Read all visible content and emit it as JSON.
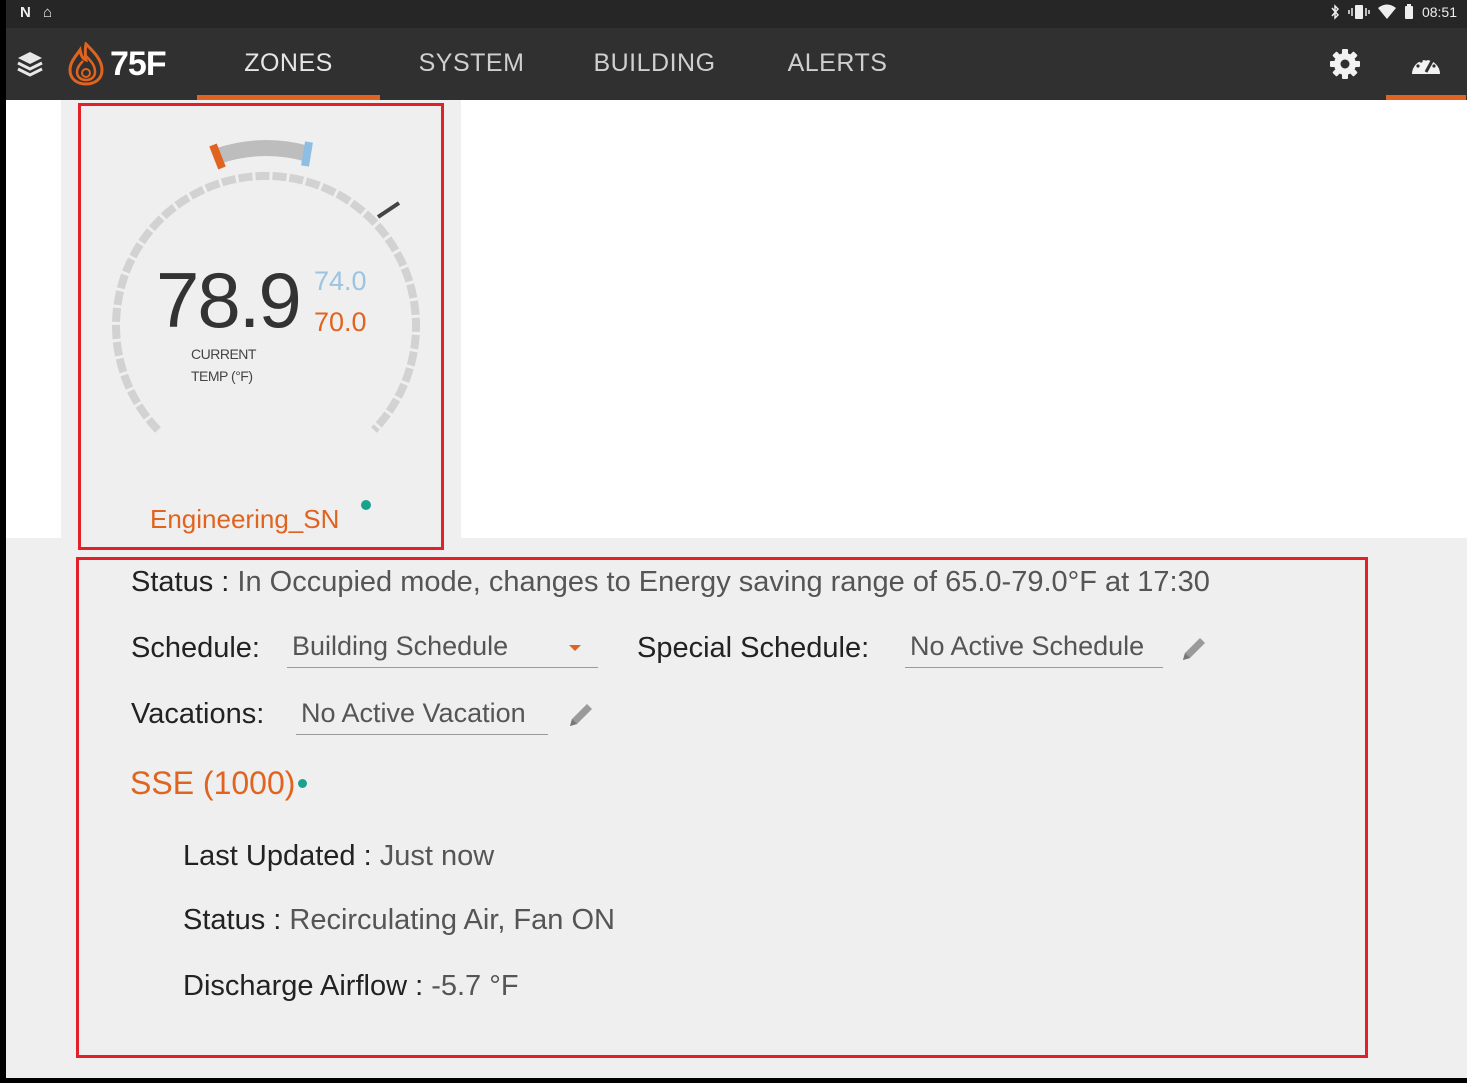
{
  "status_bar": {
    "left_icons": "N ⌂",
    "time": "08:51"
  },
  "app": {
    "logo_text": "75F"
  },
  "tabs": [
    {
      "label": "ZONES",
      "active": true
    },
    {
      "label": "SYSTEM",
      "active": false
    },
    {
      "label": "BUILDING",
      "active": false
    },
    {
      "label": "ALERTS",
      "active": false
    }
  ],
  "zone": {
    "current_temp": "78.9",
    "cooling_setpoint": "74.0",
    "heating_setpoint": "70.0",
    "temp_label_line1": "CURRENT",
    "temp_label_line2": "TEMP (°F)",
    "name": "Engineering_SN"
  },
  "details": {
    "status_label": "Status :",
    "status_value": "In Occupied mode, changes to Energy saving range of 65.0-79.0°F at 17:30",
    "schedule_label": "Schedule:",
    "schedule_value": "Building Schedule",
    "special_schedule_label": "Special Schedule:",
    "special_schedule_value": "No Active Schedule",
    "vacations_label": "Vacations:",
    "vacations_value": "No Active Vacation",
    "equipment_name": "SSE (1000)",
    "last_updated_label": "Last Updated :",
    "last_updated_value": "Just now",
    "equip_status_label": "Status :",
    "equip_status_value": "Recirculating Air, Fan ON",
    "discharge_label": "Discharge Airflow :",
    "discharge_value": "-5.7 °F"
  },
  "colors": {
    "accent": "#e0641f",
    "cool": "#9cc3e0",
    "online": "#1aa38c",
    "highlight": "#e2202a"
  }
}
